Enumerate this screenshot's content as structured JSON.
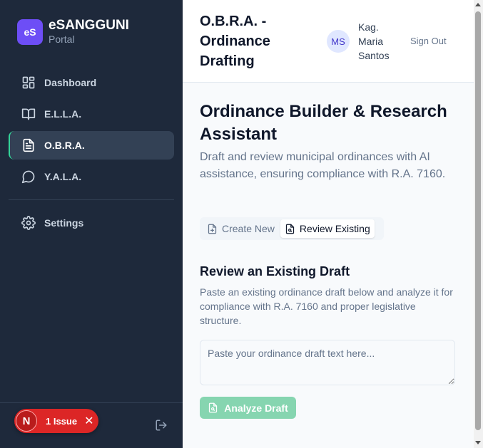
{
  "brand": {
    "logo_text": "eS",
    "name": "eSANGGUNI",
    "sub": "Portal",
    "logo_color": "#6d4ef6"
  },
  "sidebar": {
    "items": [
      {
        "label": "Dashboard",
        "icon": "dashboard-icon"
      },
      {
        "label": "E.L.L.A.",
        "icon": "book-open-icon"
      },
      {
        "label": "O.B.R.A.",
        "icon": "file-text-icon",
        "active": true
      },
      {
        "label": "Y.A.L.A.",
        "icon": "message-circle-icon"
      }
    ],
    "settings_label": "Settings",
    "active_accent": "#34d399"
  },
  "issue": {
    "badge": "N",
    "text": "1 Issue",
    "close": "✕",
    "color": "#dc2626"
  },
  "header": {
    "title": "O.B.R.A. - Ordinance Drafting",
    "avatar_initials": "MS",
    "user_name": "Kag. Maria Santos",
    "sign_out": "Sign Out"
  },
  "main": {
    "title": "Ordinance Builder & Research Assistant",
    "description": "Draft and review municipal ordinances with AI assistance, ensuring compliance with R.A. 7160.",
    "tabs": [
      {
        "label": "Create New",
        "icon": "file-plus-icon"
      },
      {
        "label": "Review Existing",
        "icon": "file-search-icon",
        "active": true
      }
    ],
    "section_title": "Review an Existing Draft",
    "section_description": "Paste an existing ordinance draft below and analyze it for compliance with R.A. 7160 and proper legislative structure.",
    "input_placeholder": "Paste your ordinance draft text here...",
    "input_value": "",
    "analyze_label": "Analyze Draft",
    "analyze_color": "#86d5b0"
  }
}
